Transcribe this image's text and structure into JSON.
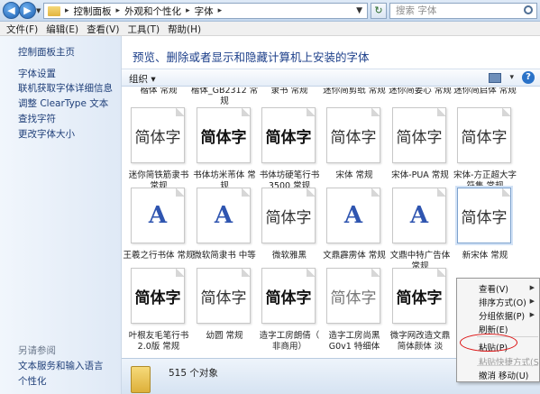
{
  "address": {
    "crumbs": [
      "控制面板",
      "外观和个性化",
      "字体"
    ],
    "search_placeholder": "搜索 字体"
  },
  "menu": [
    "文件(F)",
    "编辑(E)",
    "查看(V)",
    "工具(T)",
    "帮助(H)"
  ],
  "left_pane": {
    "home": "控制面板主页",
    "links": [
      "字体设置",
      "联机获取字体详细信息",
      "调整 ClearType 文本",
      "查找字符",
      "更改字体大小"
    ],
    "see_also_title": "另请参阅",
    "see_also": [
      "文本服务和输入语言",
      "个性化"
    ]
  },
  "content": {
    "title": "预览、删除或者显示和隐藏计算机上安装的字体",
    "organize": "组织 ▾"
  },
  "top_row_labels": [
    [
      "楷体 常规"
    ],
    [
      "楷体_GB2312 常",
      "规"
    ],
    [
      "隶书 常规"
    ],
    [
      "迷你简剪纸 常规"
    ],
    [
      "迷你简姜心 常规"
    ],
    [
      "迷你简启体 常规"
    ]
  ],
  "fonts": [
    {
      "glyph": "简体字",
      "label": [
        "迷你简铁筋隶书",
        "常规"
      ],
      "style": "normal"
    },
    {
      "glyph": "简体字",
      "label": [
        "书体坊米芾体 常",
        "规"
      ],
      "style": "bold"
    },
    {
      "glyph": "简体字",
      "label": [
        "书体坊硬笔行书",
        "3500 常规"
      ],
      "style": "bold"
    },
    {
      "glyph": "简体字",
      "label": [
        "宋体 常规"
      ],
      "style": "serif"
    },
    {
      "glyph": "简体字",
      "label": [
        "宋体-PUA 常规"
      ],
      "style": "serif"
    },
    {
      "glyph": "简体字",
      "label": [
        "宋体-方正超大字",
        "符集 常规"
      ],
      "style": "serif"
    },
    {
      "glyph": "A",
      "label": [
        "王羲之行书体 常规"
      ],
      "style": "latin"
    },
    {
      "glyph": "A",
      "label": [
        "微软简隶书 中等"
      ],
      "style": "latin"
    },
    {
      "glyph": "简体字",
      "label": [
        "微软雅黑"
      ],
      "style": "stack"
    },
    {
      "glyph": "A",
      "label": [
        "文鼎霹雳体 常规"
      ],
      "style": "latin"
    },
    {
      "glyph": "A",
      "label": [
        "文鼎中特广告体",
        "常规"
      ],
      "style": "latin"
    },
    {
      "glyph": "简体字",
      "label": [
        "新宋体 常规"
      ],
      "style": "selected"
    },
    {
      "glyph": "简体字",
      "label": [
        "叶根友毛笔行书",
        "2.0版 常规"
      ],
      "style": "bold"
    },
    {
      "glyph": "简体字",
      "label": [
        "幼圆 常规"
      ],
      "style": "normal"
    },
    {
      "glyph": "简体字",
      "label": [
        "造字工房朗倩（",
        "非商用）"
      ],
      "style": "stackbold"
    },
    {
      "glyph": "简体字",
      "label": [
        "造字工房尚黑",
        "G0v1 特细体"
      ],
      "style": "light"
    },
    {
      "glyph": "简体字",
      "label": [
        "微字网改造文鼎",
        "简体颜体 淡"
      ],
      "style": "bold"
    }
  ],
  "status": {
    "count": "515 个对象"
  },
  "context_menu": {
    "items": [
      {
        "label": "查看(V)",
        "arrow": true,
        "disabled": false
      },
      {
        "label": "排序方式(O)",
        "arrow": true,
        "disabled": false
      },
      {
        "label": "分组依据(P)",
        "arrow": true,
        "disabled": false
      },
      {
        "label": "刷新(E)",
        "arrow": false,
        "disabled": false
      },
      {
        "label": "粘贴(P)",
        "arrow": false,
        "disabled": false
      },
      {
        "label": "粘贴快捷方式(S)",
        "arrow": false,
        "disabled": true
      },
      {
        "label": "撤消 移动(U)",
        "arrow": false,
        "disabled": false
      }
    ],
    "highlight_color": "#dd1111"
  }
}
